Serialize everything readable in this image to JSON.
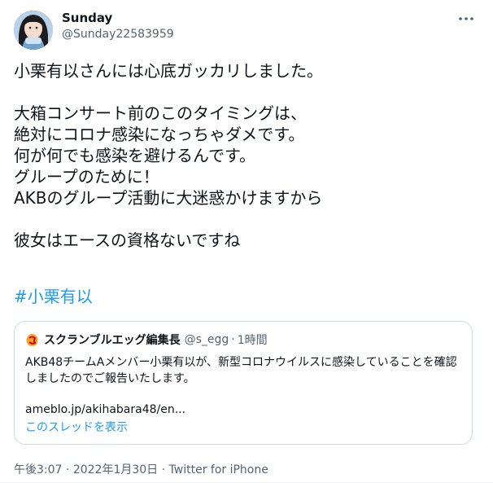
{
  "author": {
    "display_name": "Sunday",
    "handle": "@Sunday22583959"
  },
  "tweet": {
    "text": "小栗有以さんには心底ガッカリしました。\n\n大箱コンサート前のこのタイミングは、\n絶対にコロナ感染になっちゃダメです。\n何が何でも感染を避けるんです。\nグループのために！\nAKBのグループ活動に大迷惑かけますから\n\n彼女はエースの資格ないですね",
    "hashtag": "#小栗有以"
  },
  "quoted_tweet": {
    "display_name": "スクランブルエッグ編集長",
    "handle": "@s_egg",
    "separator": "·",
    "time": "1時間",
    "text": "AKB48チームAメンバー小栗有以が、新型コロナウイルスに感染していることを確認しましたのでご報告いたします。",
    "link": "ameblo.jp/akihabara48/en...",
    "show_thread": "このスレッドを表示"
  },
  "meta": {
    "time": "午後3:07",
    "separator1": " · ",
    "date": "2022年1月30日",
    "separator2": " · ",
    "source": "Twitter for iPhone"
  },
  "icons": {
    "more": "more-horizontal-icon",
    "quoted_logo": "egg-logo-icon"
  },
  "colors": {
    "link": "#1d9bf0",
    "secondary_text": "#536471",
    "border": "#cfd9de"
  }
}
